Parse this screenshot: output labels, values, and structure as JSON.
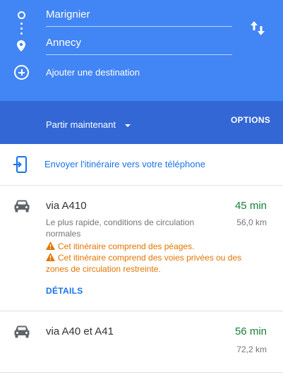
{
  "directions": {
    "origin": "Marignier",
    "destination": "Annecy",
    "add_destination_label": "Ajouter une destination",
    "depart_label": "Partir maintenant",
    "options_label": "OPTIONS"
  },
  "send_to_phone_label": "Envoyer l'itinéraire vers votre téléphone",
  "routes": [
    {
      "name": "via A410",
      "duration": "45 min",
      "distance": "56,0 km",
      "description": "Le plus rapide, conditions de circulation normales",
      "warnings": [
        "Cet itinéraire comprend des péages.",
        "Cet itinéraire comprend des voies privées ou des zones de circulation restreinte."
      ],
      "details_label": "DÉTAILS"
    },
    {
      "name": "via A40 et A41",
      "duration": "56 min",
      "distance": "72,2 km"
    }
  ],
  "icons": [
    "origin-icon",
    "destination-pin-icon",
    "swap-icon",
    "add-icon",
    "caret-down-icon",
    "send-to-phone-icon",
    "car-icon",
    "warning-icon"
  ],
  "colors": {
    "header_blue": "#4285f4",
    "header_dark_blue": "#3367d6",
    "link_blue": "#1a73e8",
    "duration_green": "#188038",
    "warning_orange": "#e37400"
  }
}
